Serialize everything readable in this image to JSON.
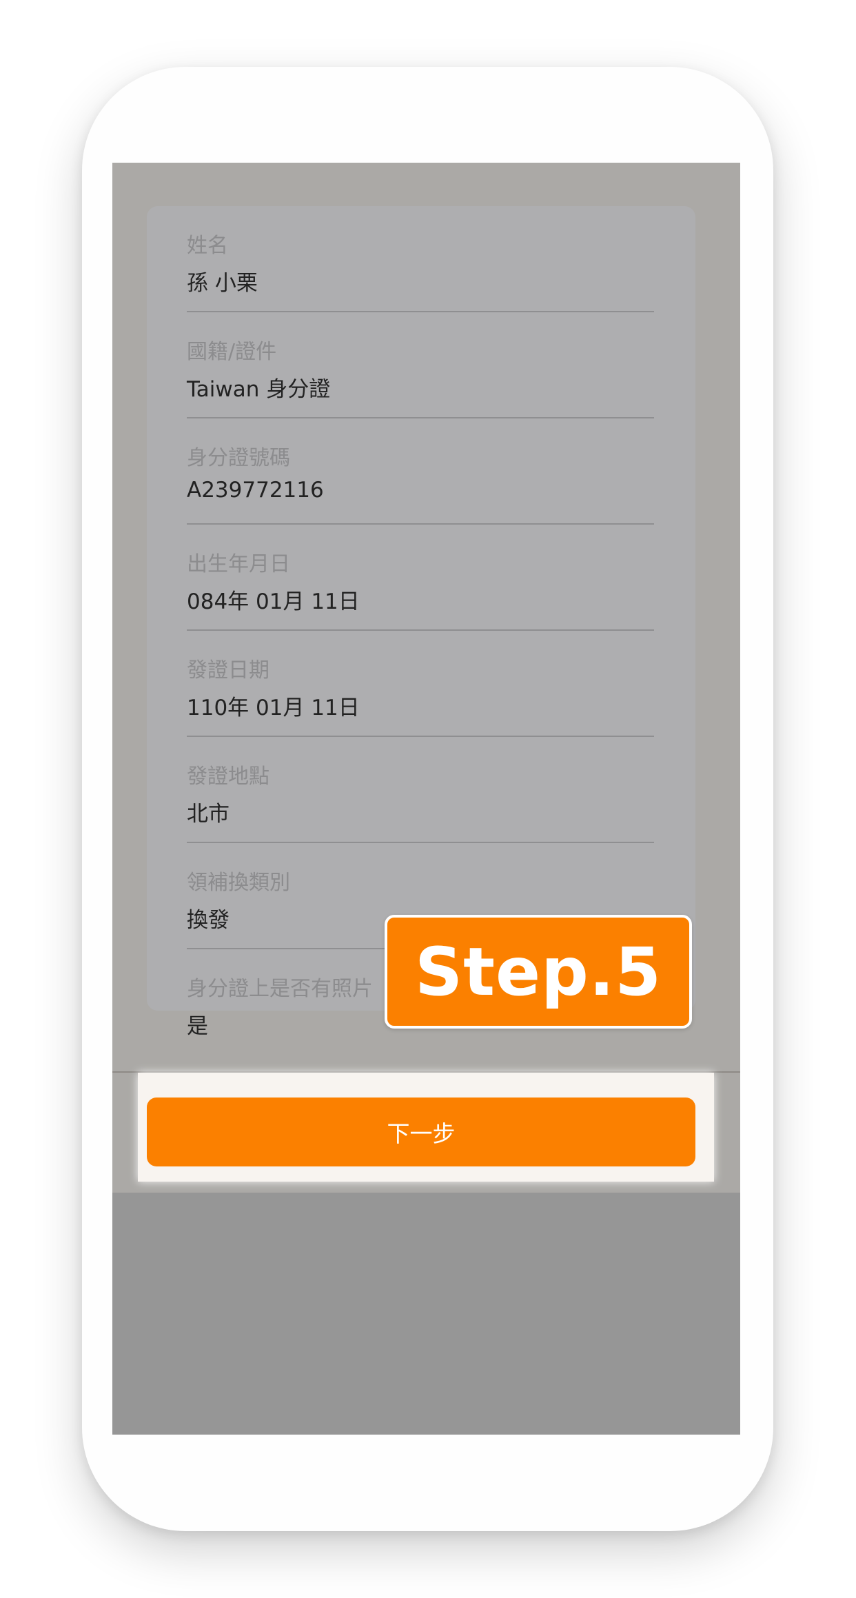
{
  "form": {
    "fields": [
      {
        "label": "姓名",
        "value": "孫 小栗"
      },
      {
        "label": "國籍/證件",
        "value": "Taiwan 身分證"
      },
      {
        "label": "身分證號碼",
        "value": "A239772116"
      },
      {
        "label": "出生年月日",
        "value": "084年 01月 11日"
      },
      {
        "label": "發證日期",
        "value": "110年 01月 11日"
      },
      {
        "label": "發證地點",
        "value": "北市"
      },
      {
        "label": "領補換類別",
        "value": "換發"
      },
      {
        "label": "身分證上是否有照片",
        "value": "是"
      }
    ]
  },
  "actions": {
    "next_label": "下一步"
  },
  "callout": {
    "text": "Step.5",
    "color": "#fb8000"
  },
  "colors": {
    "accent": "#fb8000",
    "overlay": "#aba9a6"
  }
}
